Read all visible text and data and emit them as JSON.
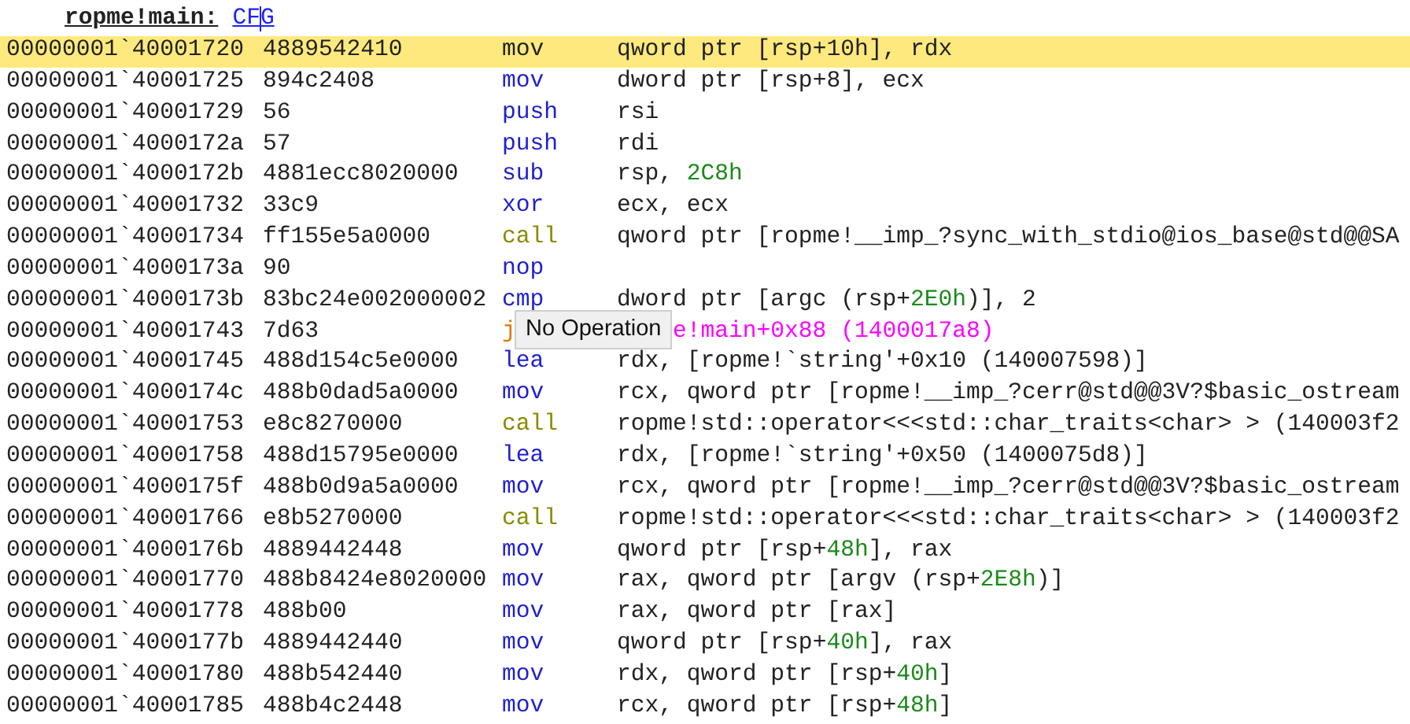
{
  "header": {
    "function": "ropme!main:",
    "link": "CFG"
  },
  "rows": [
    {
      "address": "00000001`40001720",
      "bytes": "4889542410",
      "mnemonic": "mov",
      "kind": "data",
      "operand": [
        {
          "text": "qword ptr [rsp+",
          "kind": "plain"
        },
        {
          "text": "10h",
          "kind": "number"
        },
        {
          "text": "], rdx",
          "kind": "plain"
        }
      ],
      "selected": true
    },
    {
      "address": "00000001`40001725",
      "bytes": "894c2408",
      "mnemonic": "mov",
      "kind": "data",
      "operand": [
        {
          "text": "dword ptr [rsp+8], ecx",
          "kind": "plain"
        }
      ],
      "selected": false
    },
    {
      "address": "00000001`40001729",
      "bytes": "56",
      "mnemonic": "push",
      "kind": "data",
      "operand": [
        {
          "text": "rsi",
          "kind": "plain"
        }
      ],
      "selected": false
    },
    {
      "address": "00000001`4000172a",
      "bytes": "57",
      "mnemonic": "push",
      "kind": "data",
      "operand": [
        {
          "text": "rdi",
          "kind": "plain"
        }
      ],
      "selected": false
    },
    {
      "address": "00000001`4000172b",
      "bytes": "4881ecc8020000",
      "mnemonic": "sub",
      "kind": "data",
      "operand": [
        {
          "text": "rsp, ",
          "kind": "plain"
        },
        {
          "text": "2C8h",
          "kind": "number"
        }
      ],
      "selected": false
    },
    {
      "address": "00000001`40001732",
      "bytes": "33c9",
      "mnemonic": "xor",
      "kind": "data",
      "operand": [
        {
          "text": "ecx, ecx",
          "kind": "plain"
        }
      ],
      "selected": false
    },
    {
      "address": "00000001`40001734",
      "bytes": "ff155e5a0000",
      "mnemonic": "call",
      "kind": "call",
      "operand": [
        {
          "text": "qword ptr [ropme!__imp_?sync_with_stdio@ios_base@std@@SA",
          "kind": "plain"
        }
      ],
      "selected": false
    },
    {
      "address": "00000001`4000173a",
      "bytes": "90",
      "mnemonic": "nop",
      "kind": "data",
      "operand": [],
      "selected": false
    },
    {
      "address": "00000001`4000173b",
      "bytes": "83bc24e002000002",
      "mnemonic": "cmp",
      "kind": "data",
      "operand": [
        {
          "text": "dword ptr [argc (rsp+",
          "kind": "plain"
        },
        {
          "text": "2E0h",
          "kind": "number"
        },
        {
          "text": ")], 2",
          "kind": "plain"
        }
      ],
      "selected": false
    },
    {
      "address": "00000001`40001743",
      "bytes": "7d63",
      "mnemonic": "j",
      "kind": "jump",
      "covered_by_tooltip": true,
      "operand": [
        {
          "text": "e!main+0x88 (1400017a8)",
          "kind": "symbol"
        }
      ],
      "selected": false
    },
    {
      "address": "00000001`40001745",
      "bytes": "488d154c5e0000",
      "mnemonic": "lea",
      "kind": "data",
      "operand": [
        {
          "text": "rdx, [ropme!`string'+0x10 (140007598)]",
          "kind": "plain"
        }
      ],
      "selected": false
    },
    {
      "address": "00000001`4000174c",
      "bytes": "488b0dad5a0000",
      "mnemonic": "mov",
      "kind": "data",
      "operand": [
        {
          "text": "rcx, qword ptr [ropme!__imp_?cerr@std@@3V?$basic_ostream",
          "kind": "plain"
        }
      ],
      "selected": false
    },
    {
      "address": "00000001`40001753",
      "bytes": "e8c8270000",
      "mnemonic": "call",
      "kind": "call",
      "operand": [
        {
          "text": "ropme!std::operator<<<std::char_traits<char> > (140003f2",
          "kind": "plain"
        }
      ],
      "selected": false
    },
    {
      "address": "00000001`40001758",
      "bytes": "488d15795e0000",
      "mnemonic": "lea",
      "kind": "data",
      "operand": [
        {
          "text": "rdx, [ropme!`string'+0x50 (1400075d8)]",
          "kind": "plain"
        }
      ],
      "selected": false
    },
    {
      "address": "00000001`4000175f",
      "bytes": "488b0d9a5a0000",
      "mnemonic": "mov",
      "kind": "data",
      "operand": [
        {
          "text": "rcx, qword ptr [ropme!__imp_?cerr@std@@3V?$basic_ostream",
          "kind": "plain"
        }
      ],
      "selected": false
    },
    {
      "address": "00000001`40001766",
      "bytes": "e8b5270000",
      "mnemonic": "call",
      "kind": "call",
      "operand": [
        {
          "text": "ropme!std::operator<<<std::char_traits<char> > (140003f2",
          "kind": "plain"
        }
      ],
      "selected": false
    },
    {
      "address": "00000001`4000176b",
      "bytes": "4889442448",
      "mnemonic": "mov",
      "kind": "data",
      "operand": [
        {
          "text": "qword ptr [rsp+",
          "kind": "plain"
        },
        {
          "text": "48h",
          "kind": "number"
        },
        {
          "text": "], rax",
          "kind": "plain"
        }
      ],
      "selected": false
    },
    {
      "address": "00000001`40001770",
      "bytes": "488b8424e8020000",
      "mnemonic": "mov",
      "kind": "data",
      "operand": [
        {
          "text": "rax, qword ptr [argv (rsp+",
          "kind": "plain"
        },
        {
          "text": "2E8h",
          "kind": "number"
        },
        {
          "text": ")]",
          "kind": "plain"
        }
      ],
      "selected": false
    },
    {
      "address": "00000001`40001778",
      "bytes": "488b00",
      "mnemonic": "mov",
      "kind": "data",
      "operand": [
        {
          "text": "rax, qword ptr [rax]",
          "kind": "plain"
        }
      ],
      "selected": false
    },
    {
      "address": "00000001`4000177b",
      "bytes": "4889442440",
      "mnemonic": "mov",
      "kind": "data",
      "operand": [
        {
          "text": "qword ptr [rsp+",
          "kind": "plain"
        },
        {
          "text": "40h",
          "kind": "number"
        },
        {
          "text": "], rax",
          "kind": "plain"
        }
      ],
      "selected": false
    },
    {
      "address": "00000001`40001780",
      "bytes": "488b542440",
      "mnemonic": "mov",
      "kind": "data",
      "operand": [
        {
          "text": "rdx, qword ptr [rsp+",
          "kind": "plain"
        },
        {
          "text": "40h",
          "kind": "number"
        },
        {
          "text": "]",
          "kind": "plain"
        }
      ],
      "selected": false
    },
    {
      "address": "00000001`40001785",
      "bytes": "488b4c2448",
      "mnemonic": "mov",
      "kind": "data",
      "operand": [
        {
          "text": "rcx, qword ptr [rsp+",
          "kind": "plain"
        },
        {
          "text": "48h",
          "kind": "number"
        },
        {
          "text": "]",
          "kind": "plain"
        }
      ],
      "selected": false
    }
  ],
  "tooltip": {
    "text": "No Operation"
  }
}
